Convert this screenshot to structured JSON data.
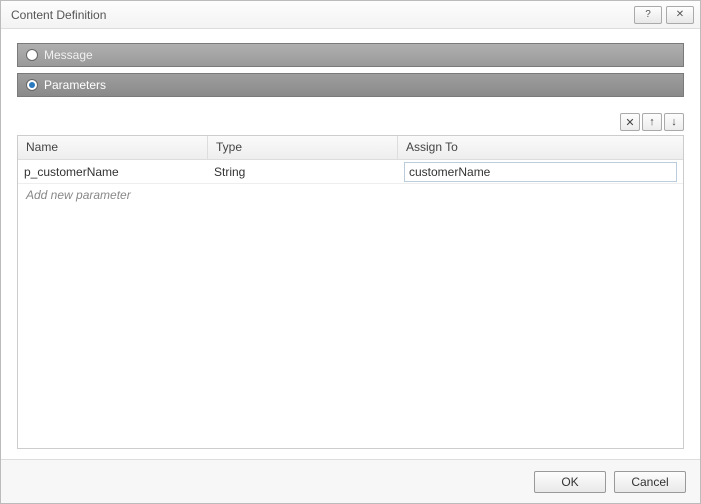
{
  "title": "Content Definition",
  "options": {
    "message": {
      "label": "Message",
      "selected": false
    },
    "parameters": {
      "label": "Parameters",
      "selected": true
    }
  },
  "toolbar": {
    "delete_glyph": "✕",
    "up_glyph": "↑",
    "down_glyph": "↓"
  },
  "table": {
    "headers": {
      "name": "Name",
      "type": "Type",
      "assign": "Assign To"
    },
    "rows": [
      {
        "name": "p_customerName",
        "type": "String",
        "assign": "customerName"
      }
    ],
    "add_hint": "Add new parameter"
  },
  "buttons": {
    "ok": "OK",
    "cancel": "Cancel"
  },
  "window": {
    "help_glyph": "?",
    "close_glyph": "✕"
  }
}
